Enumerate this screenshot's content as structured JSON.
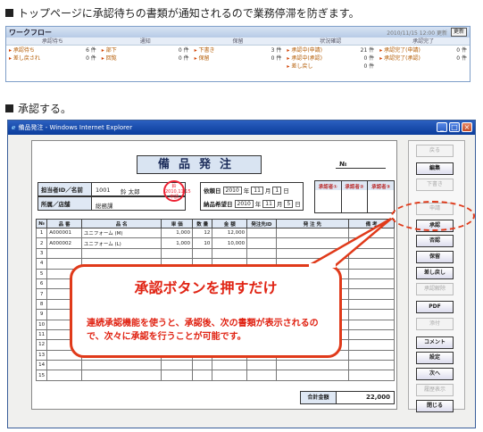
{
  "caption1": "トップページに承認待ちの書類が通知されるので業務停滞を防ぎます。",
  "caption2": "承認する。",
  "workflow": {
    "title": "ワークフロー",
    "date": "2010/11/15 12:00 更新",
    "update": "更新",
    "columns": [
      "承認待ち",
      "通知",
      "保留",
      "状況確認",
      "承認完了"
    ],
    "col1": [
      {
        "label": "承認待ち",
        "count": "6 件"
      },
      {
        "label": "差し戻され",
        "count": "0 件"
      }
    ],
    "col2": [
      {
        "label": "部下",
        "count": "0 件"
      },
      {
        "label": "回覧",
        "count": "0 件"
      }
    ],
    "col3": [
      {
        "label": "下書き",
        "count": "3 件"
      },
      {
        "label": "保留",
        "count": "0 件"
      }
    ],
    "col4": [
      {
        "label": "承認中(申請)",
        "count": "21 件"
      },
      {
        "label": "承認中(承認)",
        "count": "0 件"
      },
      {
        "label": "差し戻し",
        "count": "0 件"
      }
    ],
    "col5": [
      {
        "label": "承認完了(申請)",
        "count": "0 件"
      },
      {
        "label": "承認完了(承認)",
        "count": "0 件"
      }
    ]
  },
  "window": {
    "title": "備品発注 - Windows Internet Explorer"
  },
  "form": {
    "title": "備品発注",
    "no_label": "№",
    "person_label": "担当者ID／名前",
    "person_id": "1001",
    "person_name": "鈴 太郎",
    "dept_label": "所属／店舗",
    "dept": "総務課",
    "stamp": "鈴 2010.11.15 申請",
    "date_label": "依頼日",
    "date_y": "2010",
    "date_m": "11",
    "date_d": "1",
    "delivery_label": "納品希望日",
    "del_y": "2010",
    "del_m": "11",
    "del_d": "5",
    "year": "年",
    "month": "月",
    "day": "日",
    "approvals": [
      "承認者①",
      "承認者②",
      "承認者③"
    ],
    "headers": [
      "№",
      "品 番",
      "品 名",
      "単 価",
      "数 量",
      "金 額",
      "発注先ID",
      "発 注 先",
      "備 考"
    ],
    "rows": [
      [
        "1",
        "A000001",
        "ユニフォーム (M)",
        "1,000",
        "12",
        "12,000",
        "",
        "",
        ""
      ],
      [
        "2",
        "A000002",
        "ユニフォーム (L)",
        "1,000",
        "10",
        "10,000",
        "",
        "",
        ""
      ],
      [
        "3",
        "",
        "",
        "",
        "",
        "",
        "",
        "",
        ""
      ],
      [
        "4",
        "",
        "",
        "",
        "",
        "",
        "",
        "",
        ""
      ],
      [
        "5",
        "",
        "",
        "",
        "",
        "",
        "",
        "",
        ""
      ],
      [
        "6",
        "",
        "",
        "",
        "",
        "",
        "",
        "",
        ""
      ],
      [
        "7",
        "",
        "",
        "",
        "",
        "",
        "",
        "",
        ""
      ],
      [
        "8",
        "",
        "",
        "",
        "",
        "",
        "",
        "",
        ""
      ],
      [
        "9",
        "",
        "",
        "",
        "",
        "",
        "",
        "",
        ""
      ],
      [
        "10",
        "",
        "",
        "",
        "",
        "",
        "",
        "",
        ""
      ],
      [
        "11",
        "",
        "",
        "",
        "",
        "",
        "",
        "",
        ""
      ],
      [
        "12",
        "",
        "",
        "",
        "",
        "",
        "",
        "",
        ""
      ],
      [
        "13",
        "",
        "",
        "",
        "",
        "",
        "",
        "",
        ""
      ],
      [
        "14",
        "",
        "",
        "",
        "",
        "",
        "",
        "",
        ""
      ],
      [
        "15",
        "",
        "",
        "",
        "",
        "",
        "",
        "",
        ""
      ]
    ],
    "total_label": "合計金額",
    "total": "22,000"
  },
  "side": {
    "buttons": [
      {
        "label": "戻る",
        "enabled": false
      },
      {
        "label": "編集",
        "enabled": true
      },
      {
        "label": "下書き",
        "enabled": false
      },
      {
        "label": "申請",
        "enabled": false
      },
      {
        "label": "承認",
        "enabled": true
      },
      {
        "label": "否認",
        "enabled": true
      },
      {
        "label": "保留",
        "enabled": true
      },
      {
        "label": "差し戻し",
        "enabled": true
      },
      {
        "label": "承認解除",
        "enabled": false
      },
      {
        "label": "PDF",
        "enabled": true
      },
      {
        "label": "添付",
        "enabled": false
      },
      {
        "label": "コメント",
        "enabled": true
      },
      {
        "label": "設定",
        "enabled": true
      },
      {
        "label": "次へ",
        "enabled": true
      },
      {
        "label": "履歴表示",
        "enabled": false
      },
      {
        "label": "閉じる",
        "enabled": true
      }
    ]
  },
  "callout": {
    "title": "承認ボタンを押すだけ",
    "body": "連続承認機能を使うと、承認後、次の書類が表示されるので、次々に承認を行うことが可能です。"
  }
}
